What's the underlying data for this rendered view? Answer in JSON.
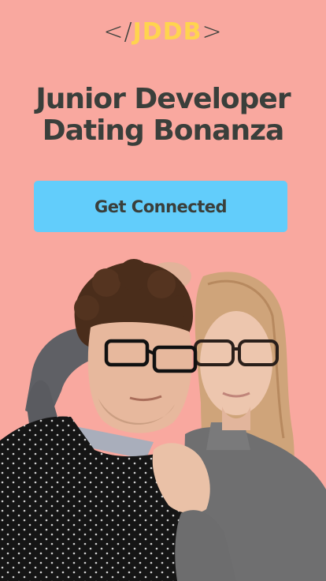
{
  "logo": {
    "open": "</",
    "brand": "JDDB",
    "close": ">"
  },
  "headline": {
    "line1": "Junior Developer",
    "line2": "Dating Bonanza"
  },
  "cta": {
    "label": "Get Connected"
  },
  "colors": {
    "background": "#f9a89f",
    "logo_accent": "#ffd44f",
    "button": "#62cdfb",
    "text": "#3a3f3b"
  }
}
